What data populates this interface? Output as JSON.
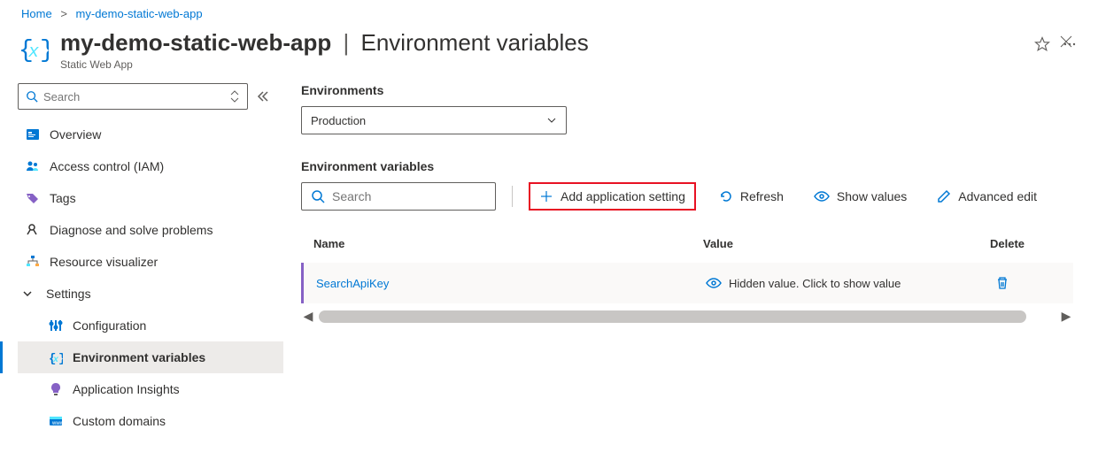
{
  "breadcrumb": {
    "items": [
      "Home",
      "my-demo-static-web-app"
    ]
  },
  "header": {
    "resource_name": "my-demo-static-web-app",
    "section_title": "Environment variables",
    "resource_type": "Static Web App"
  },
  "sidebar": {
    "search_placeholder": "Search",
    "items": [
      {
        "label": "Overview"
      },
      {
        "label": "Access control (IAM)"
      },
      {
        "label": "Tags"
      },
      {
        "label": "Diagnose and solve problems"
      },
      {
        "label": "Resource visualizer"
      }
    ],
    "settings_group": {
      "label": "Settings",
      "children": [
        {
          "label": "Configuration"
        },
        {
          "label": "Environment variables"
        },
        {
          "label": "Application Insights"
        },
        {
          "label": "Custom domains"
        }
      ]
    }
  },
  "main": {
    "environments_label": "Environments",
    "selected_environment": "Production",
    "env_vars_label": "Environment variables",
    "toolbar": {
      "search_placeholder": "Search",
      "add_label": "Add application setting",
      "refresh_label": "Refresh",
      "show_values_label": "Show values",
      "advanced_edit_label": "Advanced edit"
    },
    "table": {
      "headers": {
        "name": "Name",
        "value": "Value",
        "delete": "Delete"
      },
      "rows": [
        {
          "name": "SearchApiKey",
          "value_text": "Hidden value. Click to show value"
        }
      ]
    }
  }
}
